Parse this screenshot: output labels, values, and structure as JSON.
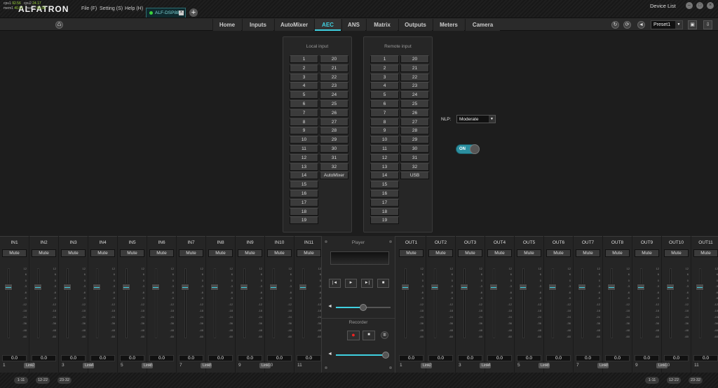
{
  "app": {
    "logo": "ALFATRON",
    "menus": [
      "File (F)",
      "Setting (S)",
      "Help (H)"
    ],
    "device_tab": "ALF-DSP88-U",
    "device_list": "Device List"
  },
  "stats": {
    "cpu1": "cpu1",
    "cpu1_val": "92.56",
    "cpu2": "cpu2",
    "cpu2_val": "24.17",
    "mem1": "mem1",
    "mem1_val": "40.57",
    "mem2": "mem2",
    "mem2_val": "55.56"
  },
  "nav": {
    "tabs": [
      "Home",
      "Inputs",
      "AutoMixer",
      "AEC",
      "ANS",
      "Matrix",
      "Outputs",
      "Meters",
      "Camera"
    ],
    "active": "AEC",
    "preset": "Preset1"
  },
  "aec": {
    "local_title": "Local input",
    "remote_title": "Remote input",
    "left_col": [
      "1",
      "2",
      "3",
      "4",
      "5",
      "6",
      "7",
      "8",
      "9",
      "10",
      "11",
      "12",
      "13",
      "14",
      "15",
      "16",
      "17",
      "18",
      "19"
    ],
    "local_right": [
      "20",
      "21",
      "22",
      "23",
      "24",
      "25",
      "26",
      "27",
      "28",
      "29",
      "30",
      "31",
      "32",
      "AutoMixer"
    ],
    "remote_right": [
      "20",
      "21",
      "22",
      "23",
      "24",
      "25",
      "26",
      "27",
      "28",
      "29",
      "30",
      "31",
      "32",
      "USB"
    ],
    "nlp_label": "NLP:",
    "nlp_value": "Moderate",
    "toggle": "ON"
  },
  "mixer": {
    "inputs": [
      "IN1",
      "IN2",
      "IN3",
      "IN4",
      "IN5",
      "IN6",
      "IN7",
      "IN8",
      "IN9",
      "IN10",
      "IN11"
    ],
    "outputs": [
      "OUT1",
      "OUT2",
      "OUT3",
      "OUT4",
      "OUT5",
      "OUT6",
      "OUT7",
      "OUT8",
      "OUT9",
      "OUT10",
      "OUT11"
    ],
    "mute": "Mute",
    "value": "0.0",
    "link": "Link",
    "scale": [
      "12",
      "6",
      "0",
      "-3",
      "-6",
      "-9",
      "-12",
      "-18",
      "-24",
      "-36",
      "-48",
      "-60"
    ],
    "player": "Player",
    "recorder": "Recorder"
  },
  "pages_left": [
    "1-11",
    "12-22",
    "23-32"
  ],
  "pages_right": [
    "1-11",
    "12-22",
    "23-32"
  ]
}
